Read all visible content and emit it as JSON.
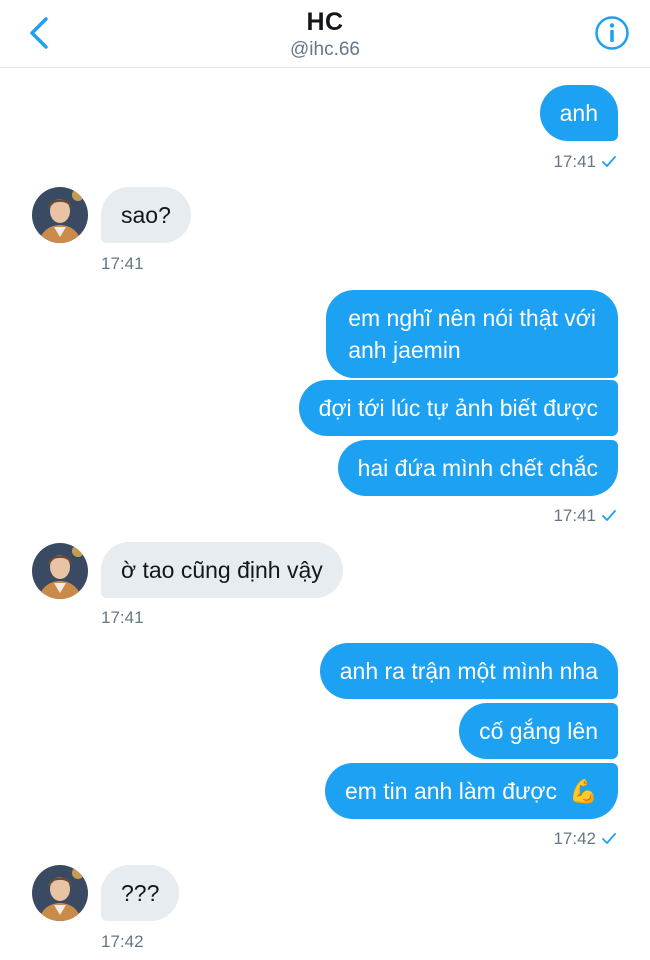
{
  "header": {
    "title": "HC",
    "handle": "@ihc.66"
  },
  "colors": {
    "accent": "#1da1f2",
    "received_bubble": "#e6ecf0",
    "muted_text": "#657786"
  },
  "icons": {
    "back": "chevron-left-icon",
    "info": "info-circle-icon",
    "read": "checkmark-icon",
    "emoji": "flexed-biceps-emoji"
  },
  "messages": [
    {
      "from": "me",
      "text": "anh",
      "time": "17:41"
    },
    {
      "from": "them",
      "text": "sao?",
      "time": "17:41"
    },
    {
      "from": "me",
      "lines": [
        "em nghĩ nên nói thật với",
        "anh jaemin"
      ]
    },
    {
      "from": "me",
      "text": "đợi tới lúc tự ảnh biết được"
    },
    {
      "from": "me",
      "text": "hai đứa mình chết chắc",
      "time": "17:41"
    },
    {
      "from": "them",
      "text": "ờ tao cũng định vậy",
      "time": "17:41"
    },
    {
      "from": "me",
      "text": "anh ra trận một mình nha"
    },
    {
      "from": "me",
      "text": "cố gắng lên"
    },
    {
      "from": "me",
      "text": "em tin anh làm được",
      "emoji": "💪",
      "time": "17:42"
    },
    {
      "from": "them",
      "text": "???",
      "time": "17:42"
    }
  ]
}
